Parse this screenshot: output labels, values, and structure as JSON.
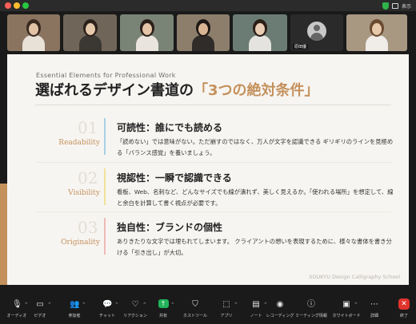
{
  "window": {
    "view_label": "表示"
  },
  "participants": [
    {
      "name": "",
      "type": "video",
      "bg": "#8a7460",
      "skin": "#e2c3a6",
      "hair": "#3a2a20",
      "cloth": "#e7e1d8"
    },
    {
      "name": "",
      "type": "video",
      "bg": "#6f6659",
      "skin": "#e6c8ad",
      "hair": "#2c201a",
      "cloth": "#3b3733"
    },
    {
      "name": "",
      "type": "video",
      "bg": "#7a8476",
      "skin": "#e4c5a8",
      "hair": "#2b1f18",
      "cloth": "#e9e5de"
    },
    {
      "name": "",
      "type": "video",
      "bg": "#8d7e6c",
      "skin": "#d9b594",
      "hair": "#1f1915",
      "cloth": "#2f2c2a"
    },
    {
      "name": "",
      "type": "video",
      "bg": "#6b7c75",
      "skin": "#e9cdb4",
      "hair": "#2a1e17",
      "cloth": "#e4e3df"
    },
    {
      "name": "原田優",
      "type": "avatar",
      "bg": "#2a2a2a"
    },
    {
      "name": "",
      "type": "video",
      "bg": "#a89882",
      "skin": "#e7c9ab",
      "hair": "#6b4a31",
      "cloth": "#f0ede8"
    }
  ],
  "slide": {
    "eyebrow": "Essential Elements for Professional Work",
    "heading_prefix": "選ばれるデザイン書道の",
    "heading_highlight": "「3つの絶対条件」",
    "accent_color": "#c4915c",
    "rows": [
      {
        "num": "01",
        "label": "Readability",
        "title": "可読性：誰にでも読める",
        "body": "「読めない」では意味がない。ただ崩すのではなく、万人が文字を認識できる ギリギリのラインを見極める「バランス感覚」を養いましょう。",
        "bar_color": "#a7d3e2"
      },
      {
        "num": "02",
        "label": "Visibility",
        "title": "視認性：一瞬で認識できる",
        "body": "看板、Web、名刺など、どんなサイズでも線が潰れず、美しく見えるか。「使われる場所」を想定して、線と余白を計算して書く視点が必要です。",
        "bar_color": "#f2e29a"
      },
      {
        "num": "03",
        "label": "Originality",
        "title": "独自性：ブランドの個性",
        "body": "ありきたりな文字では埋もれてしまいます。 クライアントの想いを表現するために、様々な書体を書き分ける「引き出し」が大切。",
        "bar_color": "#eeb9b6"
      }
    ],
    "footer": "SOUKYU Design Calligraphy School"
  },
  "toolbar": [
    {
      "id": "audio",
      "label": "オーディオ",
      "icon": "microphone-icon",
      "glyph": "🎙",
      "caret": true
    },
    {
      "id": "video",
      "label": "ビデオ",
      "icon": "camera-icon",
      "glyph": "▭",
      "caret": true
    },
    {
      "id": "participants",
      "label": "参加者",
      "icon": "participants-icon",
      "glyph": "👥",
      "caret": true
    },
    {
      "id": "chat",
      "label": "チャット",
      "icon": "chat-icon",
      "glyph": "💬",
      "caret": true
    },
    {
      "id": "reactions",
      "label": "リアクション",
      "icon": "heart-icon",
      "glyph": "♡",
      "caret": true
    },
    {
      "id": "share",
      "label": "共有",
      "icon": "share-screen-icon",
      "glyph": "↑",
      "caret": true
    },
    {
      "id": "hostools",
      "label": "ホストツール",
      "icon": "shield-icon",
      "glyph": "⛉",
      "caret": false
    },
    {
      "id": "apps",
      "label": "アプリ",
      "icon": "apps-icon",
      "glyph": "⬚",
      "caret": true
    },
    {
      "id": "notes",
      "label": "ノート",
      "icon": "notes-icon",
      "glyph": "▤",
      "caret": true
    },
    {
      "id": "record",
      "label": "レコーディング",
      "icon": "record-icon",
      "glyph": "◉",
      "caret": false
    },
    {
      "id": "info",
      "label": "ミーティング情報",
      "icon": "info-icon",
      "glyph": "ⓘ",
      "caret": false
    },
    {
      "id": "whiteboard",
      "label": "ホワイトボード",
      "icon": "whiteboard-icon",
      "glyph": "▣",
      "caret": true
    },
    {
      "id": "more",
      "label": "詳細",
      "icon": "more-icon",
      "glyph": "⋯",
      "caret": false
    },
    {
      "id": "end",
      "label": "終了",
      "icon": "close-icon",
      "glyph": "✕",
      "caret": false
    }
  ]
}
